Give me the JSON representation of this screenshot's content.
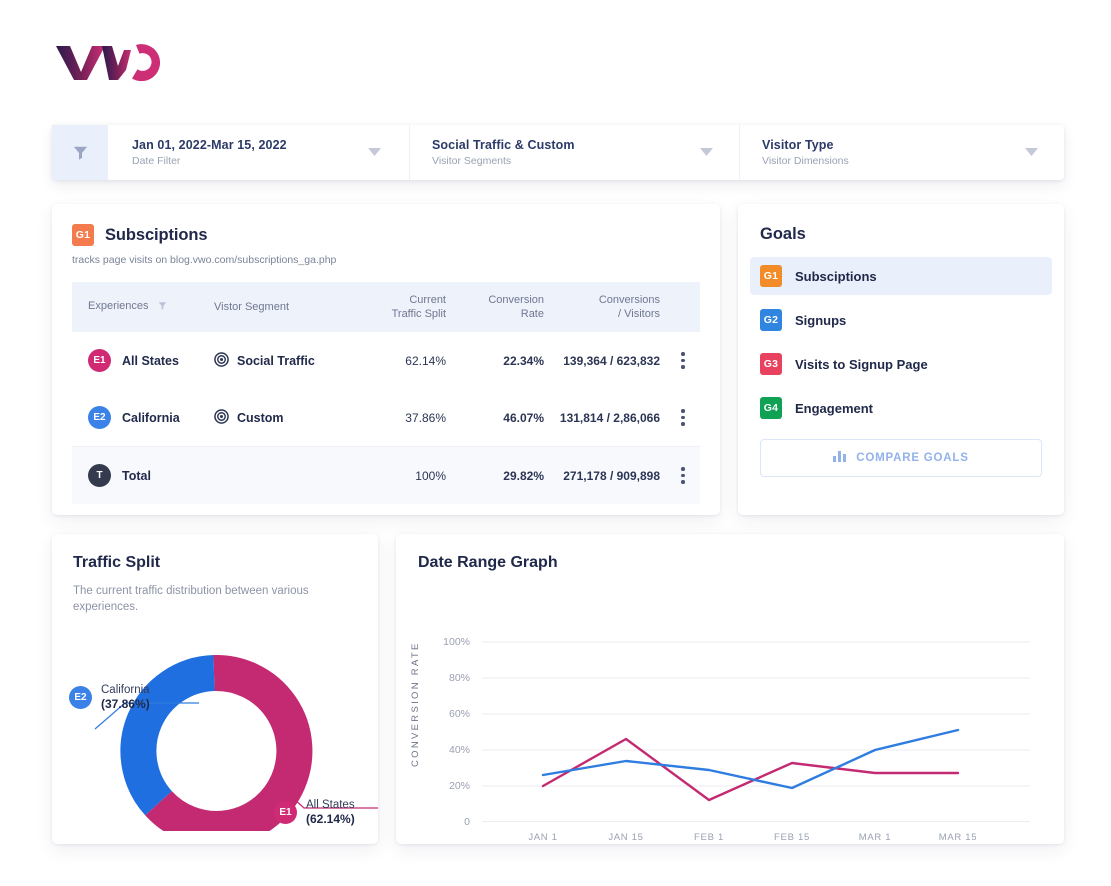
{
  "brand": {
    "logo_text": "VWO",
    "primary_dark": "#2b1a4e",
    "primary_pink": "#c2276b"
  },
  "filter_bar": {
    "filter_icon": "funnel-icon",
    "items": [
      {
        "title": "Jan 01, 2022-Mar 15, 2022",
        "subtitle": "Date Filter",
        "caret": "chevron-down-icon"
      },
      {
        "title": "Social Traffic & Custom",
        "subtitle": "Visitor Segments",
        "caret": "chevron-down-icon"
      },
      {
        "title": "Visitor Type",
        "subtitle": "Visitor Dimensions",
        "caret": "chevron-down-icon"
      }
    ]
  },
  "subscriptions": {
    "badge": "G1",
    "badge_color": "#f47b4e",
    "title": "Subsciptions",
    "description": "tracks page visits on blog.vwo.com/subscriptions_ga.php",
    "columns": {
      "experiences": "Experiences",
      "experiences_icon": "filter-icon",
      "visitor_segment": "Vistor Segment",
      "current_traffic_split": "Current\nTraffic Split",
      "current_traffic_split_l1": "Current",
      "current_traffic_split_l2": "Traffic Split",
      "conversion_rate_l1": "Conversion",
      "conversion_rate_l2": "Rate",
      "conversions_visitors_l1": "Conversions",
      "conversions_visitors_l2": "/ Visitors"
    },
    "rows": [
      {
        "badge": "E1",
        "badge_color": "#cf2a73",
        "experience": "All States",
        "segment": "Social Traffic",
        "segment_icon": "target-icon",
        "traffic_split": "62.14%",
        "conversion_rate": "22.34%",
        "conversions_visitors": "139,364 / 623,832",
        "menu_icon": "kebab-menu-icon"
      },
      {
        "badge": "E2",
        "badge_color": "#3b82e8",
        "experience": "California",
        "segment": "Custom",
        "segment_icon": "target-icon",
        "traffic_split": "37.86%",
        "conversion_rate": "46.07%",
        "conversions_visitors": "131,814 / 2,86,066",
        "menu_icon": "kebab-menu-icon"
      },
      {
        "badge": "T",
        "badge_color": "#333a४",
        "experience": "Total",
        "segment": "",
        "segment_icon": "",
        "traffic_split": "100%",
        "conversion_rate": "29.82%",
        "conversions_visitors": "271,178 / 909,898",
        "menu_icon": "kebab-menu-icon"
      }
    ]
  },
  "goals": {
    "title": "Goals",
    "items": [
      {
        "badge": "G1",
        "label": "Subsciptions",
        "color": "#f28c28",
        "active": true
      },
      {
        "badge": "G2",
        "label": "Signups",
        "color": "#2f85e0",
        "active": false
      },
      {
        "badge": "G3",
        "label": "Visits to Signup Page",
        "color": "#e8425f",
        "active": false
      },
      {
        "badge": "G4",
        "label": "Engagement",
        "color": "#10a254",
        "active": false
      }
    ],
    "compare_button": {
      "label": "COMPARE GOALS",
      "icon": "bar-chart-icon"
    }
  },
  "traffic_split": {
    "title": "Traffic Split",
    "description": "The current traffic distribution between various experiences.",
    "chart_data": {
      "type": "pie",
      "title": "Traffic Split",
      "categories": [
        "All States",
        "California"
      ],
      "values": [
        62.14,
        37.86
      ],
      "labels": [
        "62.14%",
        "37.86%"
      ],
      "colors": [
        "#c42a72",
        "#1f6fe0"
      ],
      "badges": [
        "E1",
        "E2"
      ],
      "donut": true,
      "legend": "callout-labels"
    }
  },
  "date_range_graph": {
    "title": "Date Range Graph",
    "chart_data": {
      "type": "line",
      "title": "Date Range Graph",
      "xlabel": "",
      "ylabel": "CONVERSION RATE",
      "x": [
        "JAN 1",
        "JAN 15",
        "FEB 1",
        "FEB 15",
        "MAR 1",
        "MAR 15"
      ],
      "ytick_labels": [
        "0",
        "20%",
        "40%",
        "60%",
        "80%",
        "100%"
      ],
      "ylim": [
        0,
        100
      ],
      "grid": true,
      "legend_position": "none",
      "series": [
        {
          "name": "All States",
          "color": "#c42a72",
          "values": [
            20,
            46,
            12,
            33,
            27,
            27
          ]
        },
        {
          "name": "California",
          "color": "#2f7de0",
          "values": [
            26,
            34,
            29,
            19,
            40,
            51
          ]
        }
      ]
    }
  }
}
